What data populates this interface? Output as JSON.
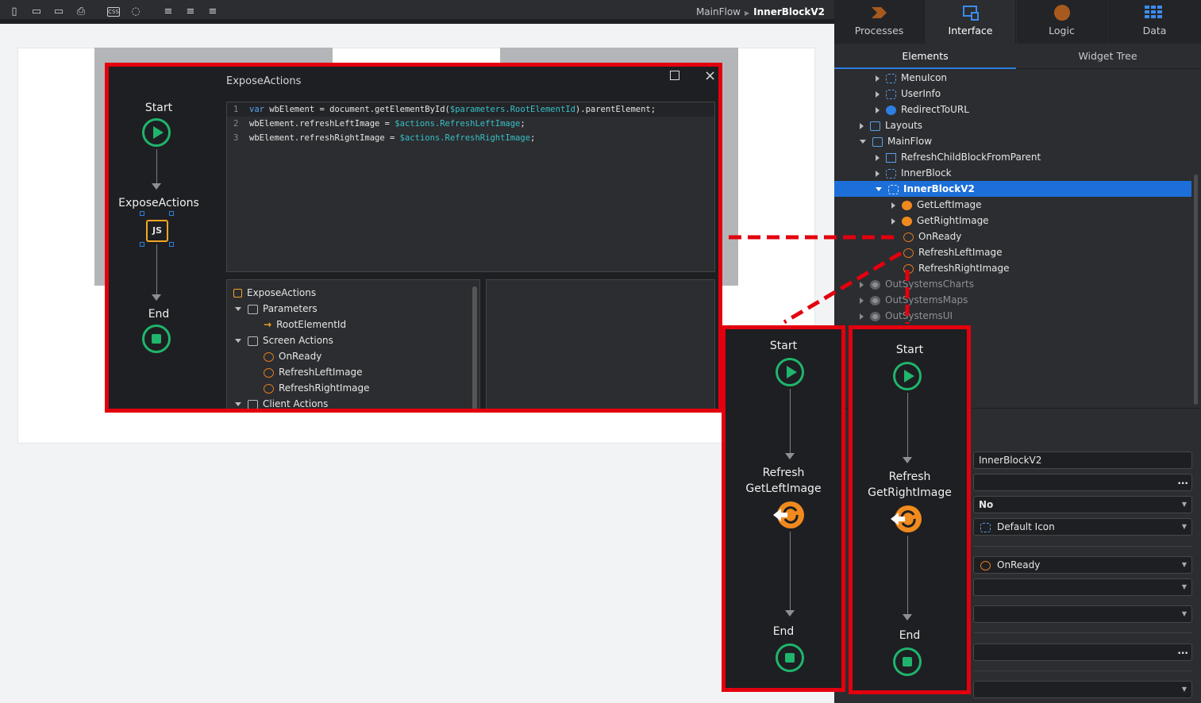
{
  "toolbar": {
    "icons": [
      "phone-icon",
      "tablet-icon",
      "desktop-icon",
      "print-icon",
      "css-icon",
      "theme-icon",
      "align-left-icon",
      "align-center-icon",
      "align-right-icon"
    ],
    "css_label": "CSS",
    "breadcrumb": {
      "parent": "MainFlow",
      "current": "InnerBlockV2"
    }
  },
  "editor": {
    "title": "ExposeActions",
    "flow": {
      "start": "Start",
      "node": "ExposeActions",
      "node_badge": "JS",
      "end": "End"
    },
    "code_lines": [
      {
        "num": "1",
        "pre": "var",
        "mid": " wbElement = document.getElementById(",
        "var": "$parameters.RootElementId",
        "post": ").parentElement;"
      },
      {
        "num": "2",
        "pre": "",
        "mid": "wbElement.refreshLeftImage = ",
        "var": "$actions.RefreshLeftImage",
        "post": ";"
      },
      {
        "num": "3",
        "pre": "",
        "mid": "wbElement.refreshRightImage = ",
        "var": "$actions.RefreshRightImage",
        "post": ";"
      }
    ],
    "tree": {
      "root": "ExposeActions",
      "parameters": "Parameters",
      "param_item": "RootElementId",
      "screen_actions": "Screen Actions",
      "actions": [
        "OnReady",
        "RefreshLeftImage",
        "RefreshRightImage"
      ],
      "client_actions": "Client Actions"
    }
  },
  "right_panel": {
    "tabs": [
      "Processes",
      "Interface",
      "Logic",
      "Data"
    ],
    "sub_tabs": [
      "Elements",
      "Widget Tree"
    ],
    "tree": [
      {
        "label": "MenuIcon"
      },
      {
        "label": "UserInfo"
      },
      {
        "label": "RedirectToURL"
      },
      {
        "label": "Layouts"
      },
      {
        "label": "MainFlow"
      },
      {
        "label": "RefreshChildBlockFromParent"
      },
      {
        "label": "InnerBlock"
      },
      {
        "label": "InnerBlockV2"
      },
      {
        "label": "GetLeftImage"
      },
      {
        "label": "GetRightImage"
      },
      {
        "label": "OnReady"
      },
      {
        "label": "RefreshLeftImage"
      },
      {
        "label": "RefreshRightImage"
      },
      {
        "label": "OutSystemsCharts"
      },
      {
        "label": "OutSystemsMaps"
      },
      {
        "label": "OutSystemsUI"
      }
    ],
    "properties": {
      "name": "InnerBlockV2",
      "description": "",
      "public": "No",
      "icon": "Default Icon",
      "on_ready": "OnReady",
      "on_render": "",
      "on_after_fetch": "",
      "field_extra": "",
      "field_last": ""
    }
  },
  "flow_left": {
    "start": "Start",
    "action_line1": "Refresh",
    "action_line2": "GetLeftImage",
    "end": "End"
  },
  "flow_right": {
    "start": "Start",
    "action_line1": "Refresh",
    "action_line2": "GetRightImage",
    "end": "End"
  },
  "colors": {
    "highlight_border": "#e3000e",
    "selection": "#1c6fd8",
    "start_end": "#1fb56c",
    "action": "#f08a1e"
  }
}
